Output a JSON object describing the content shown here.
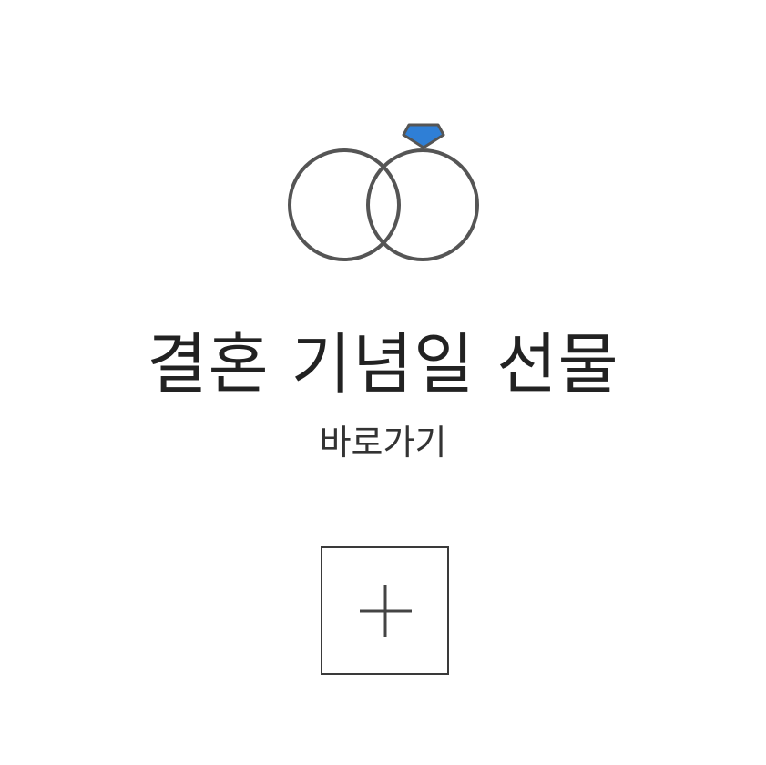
{
  "banner": {
    "icon": "wedding-rings-icon",
    "title": "결혼 기념일 선물",
    "link_label": "바로가기",
    "expand_icon": "plus-icon"
  },
  "colors": {
    "ring_stroke": "#555555",
    "gem": "#2f7fd6",
    "text": "#222222",
    "button_border": "#3a3a3a"
  }
}
